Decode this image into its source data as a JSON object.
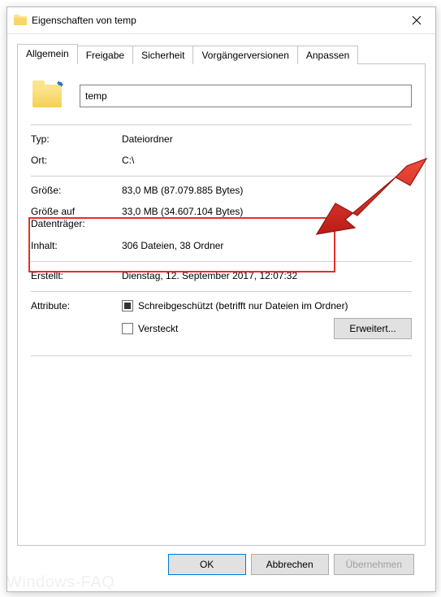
{
  "window": {
    "title": "Eigenschaften von temp"
  },
  "tabs": {
    "general": "Allgemein",
    "sharing": "Freigabe",
    "security": "Sicherheit",
    "previous_versions": "Vorgängerversionen",
    "customize": "Anpassen"
  },
  "folder": {
    "name": "temp"
  },
  "props": {
    "type_label": "Typ:",
    "type_value": "Dateiordner",
    "location_label": "Ort:",
    "location_value": "C:\\",
    "size_label": "Größe:",
    "size_value": "83,0 MB (87.079.885 Bytes)",
    "size_on_disk_label": "Größe auf Datenträger:",
    "size_on_disk_value": "33,0 MB (34.607.104 Bytes)",
    "contents_label": "Inhalt:",
    "contents_value": "306 Dateien, 38 Ordner",
    "created_label": "Erstellt:",
    "created_value": "Dienstag, 12. September 2017, 12:07:32",
    "attributes_label": "Attribute:",
    "readonly_label": "Schreibgeschützt (betrifft nur Dateien im Ordner)",
    "hidden_label": "Versteckt",
    "advanced_label": "Erweitert..."
  },
  "buttons": {
    "ok": "OK",
    "cancel": "Abbrechen",
    "apply": "Übernehmen"
  },
  "watermark": "Windows-FAQ"
}
